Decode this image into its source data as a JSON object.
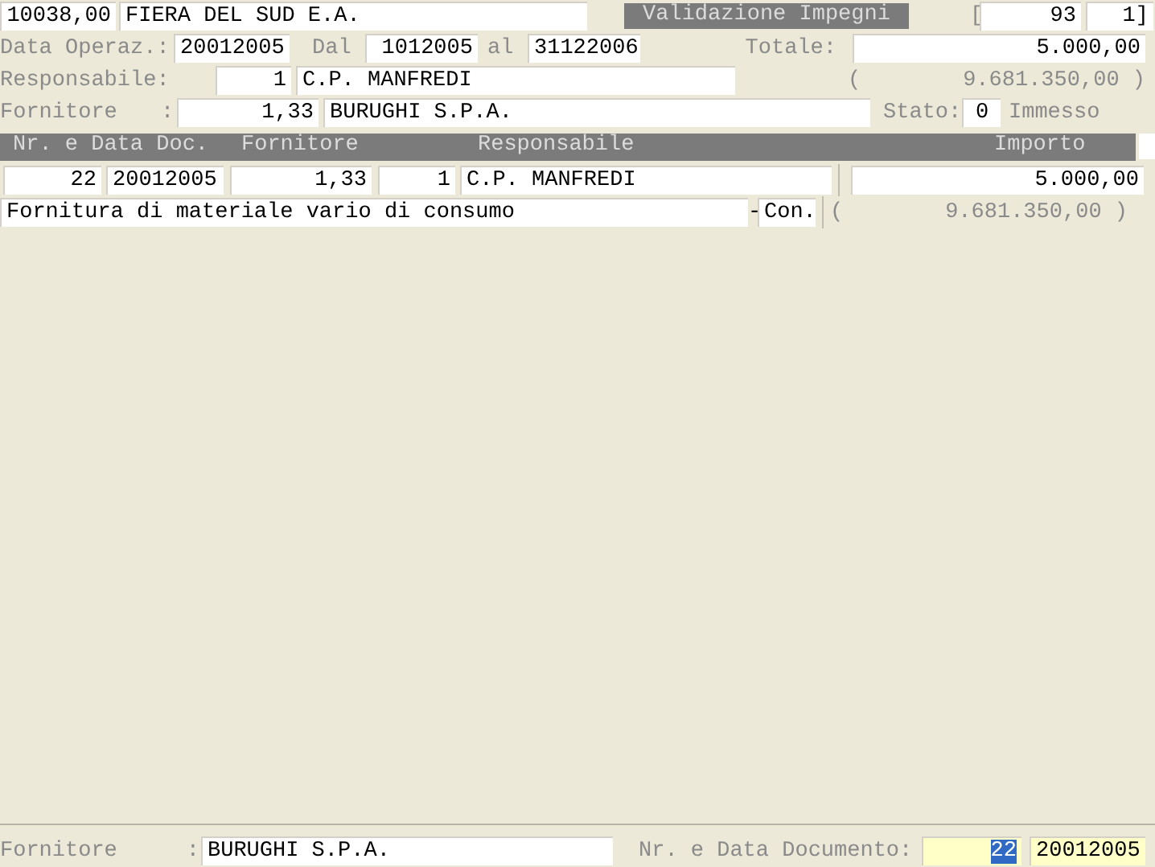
{
  "header": {
    "amount": "10038,00",
    "entity": "FIERA DEL SUD E.A.",
    "title": "Validazione Impegni",
    "bracket": "[",
    "number": "93",
    "page": "1]"
  },
  "operation": {
    "date_label": "Data Operaz.:",
    "date": "20012005",
    "from_label": "Dal",
    "from": "1012005",
    "to_label": "al",
    "to": "31122006",
    "total_label": "Totale:",
    "total": "5.000,00"
  },
  "manager": {
    "label": "Responsabile:",
    "code": "1",
    "name": "C.P. MANFREDI",
    "paren": "(",
    "amount": "9.681.350,00 )"
  },
  "supplier": {
    "label": "Fornitore",
    "colon": ":",
    "code": "1,33",
    "name": "BURUGHI S.P.A.",
    "status_label": "Stato:",
    "status_code": "0",
    "status_text": "Immesso"
  },
  "table": {
    "columns": [
      "Nr. e Data Doc.",
      "Fornitore",
      "Responsabile",
      "Importo"
    ],
    "rows": [
      {
        "number": "22",
        "date": "20012005",
        "supplier": "1,33",
        "manager_code": "1",
        "manager_name": "C.P. MANFREDI",
        "amount": "5.000,00",
        "description": "Fornitura di materiale vario di consumo",
        "dash": "-",
        "type": "Con.",
        "paren": "(",
        "total": "9.681.350,00 )"
      }
    ]
  },
  "footer": {
    "supplier_label": "Fornitore",
    "colon": ":",
    "supplier": "BURUGHI S.P.A.",
    "document_label": "Nr. e Data Documento:",
    "document_number": "22",
    "number_selected": true,
    "document_date": "20012005"
  }
}
